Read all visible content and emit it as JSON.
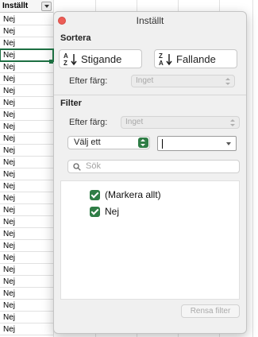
{
  "sheet": {
    "header": "Inställt",
    "rows": [
      "Nej",
      "Nej",
      "Nej",
      "Nej",
      "Nej",
      "Nej",
      "Nej",
      "Nej",
      "Nej",
      "Nej",
      "Nej",
      "Nej",
      "Nej",
      "Nej",
      "Nej",
      "Nej",
      "Nej",
      "Nej",
      "Nej",
      "Nej",
      "Nej",
      "Nej",
      "Nej",
      "Nej",
      "Nej",
      "Nej",
      "Nej"
    ]
  },
  "panel": {
    "title": "Inställt",
    "sort": {
      "section": "Sortera",
      "ascending": "Stigande",
      "descending": "Fallande",
      "by_color_label": "Efter färg:",
      "by_color_value": "Inget"
    },
    "filter": {
      "section": "Filter",
      "by_color_label": "Efter färg:",
      "by_color_value": "Inget",
      "condition": "Välj ett",
      "value": "",
      "search_placeholder": "Sök",
      "items": [
        {
          "label": "(Markera allt)",
          "checked": true
        },
        {
          "label": "Nej",
          "checked": true
        }
      ],
      "clear": "Rensa filter"
    }
  },
  "colors": {
    "accent": "#2f7d46",
    "close": "#ec5d56"
  }
}
